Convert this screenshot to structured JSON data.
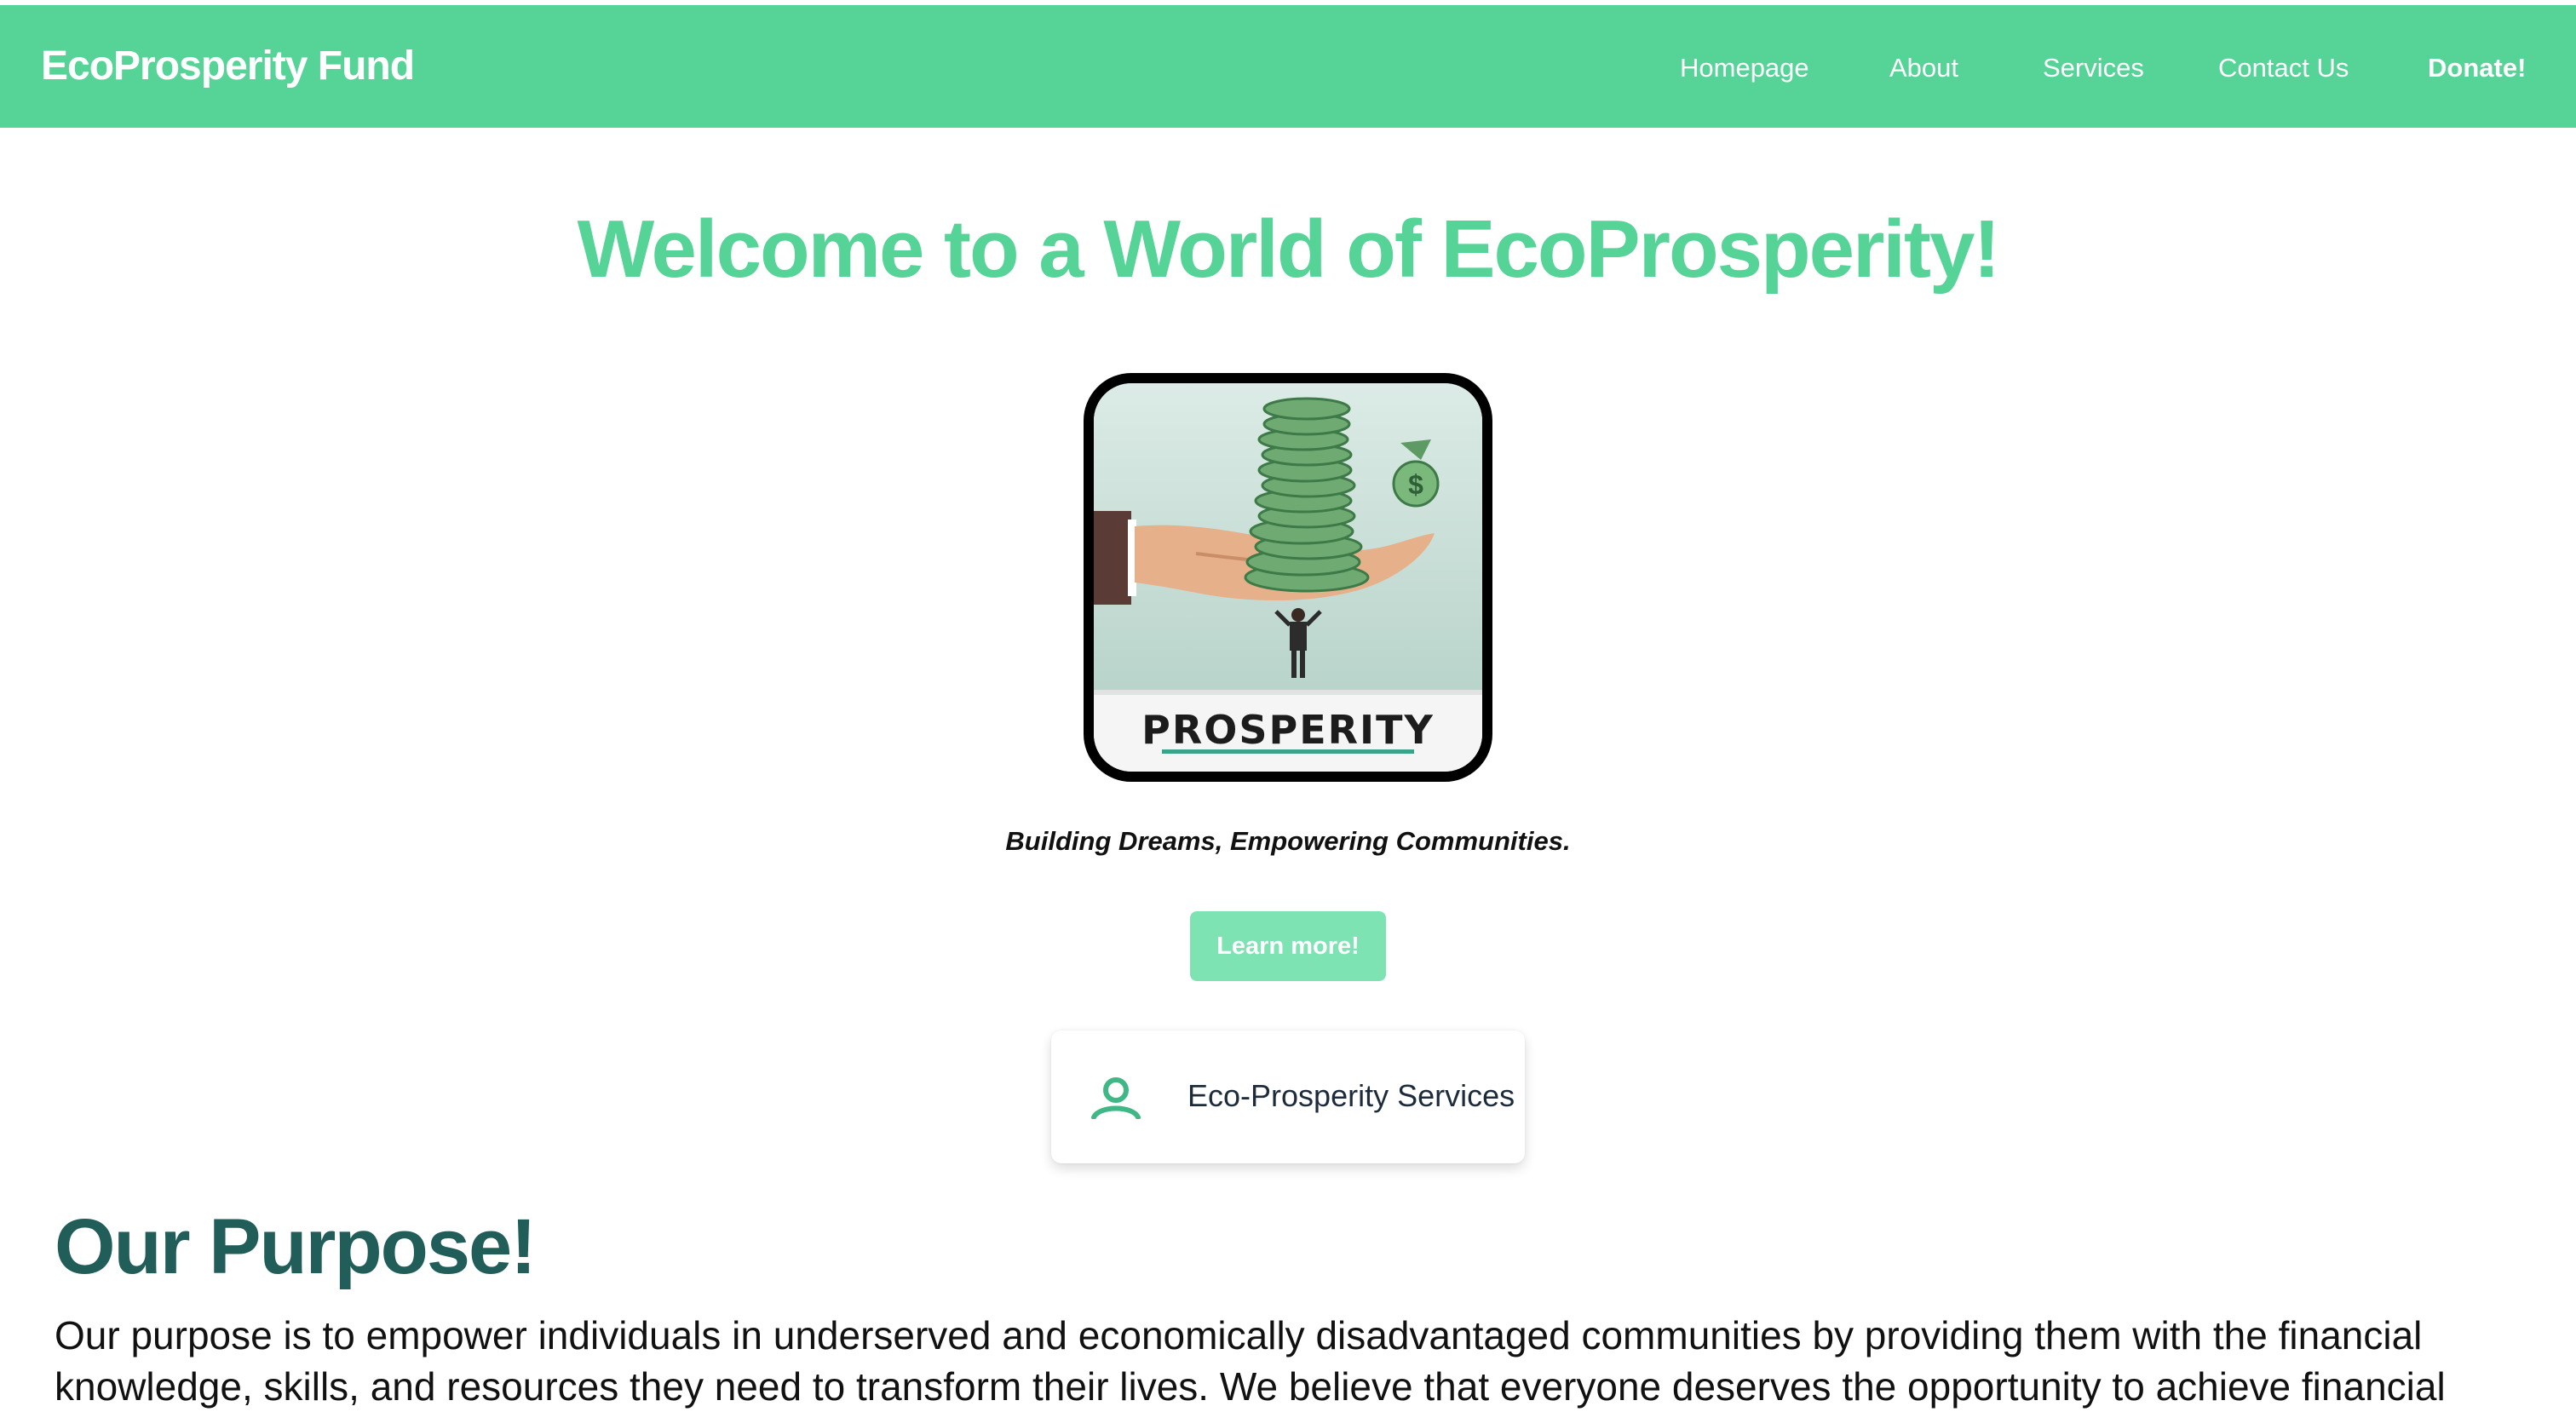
{
  "nav": {
    "brand": "EcoProsperity Fund",
    "links": [
      {
        "label": "Homepage"
      },
      {
        "label": "About"
      },
      {
        "label": "Services"
      },
      {
        "label": "Contact Us"
      },
      {
        "label": "Donate!"
      }
    ]
  },
  "hero": {
    "title": "Welcome to a World of EcoProsperity!",
    "image_caption": "PROSPERITY",
    "image_icon": "hand-holding-coins-illustration",
    "tagline": "Building Dreams, Empowering Communities.",
    "cta_label": "Learn more!"
  },
  "services_card": {
    "icon": "user-icon",
    "label": "Eco-Prosperity Services"
  },
  "purpose": {
    "title": "Our Purpose!",
    "body": "Our purpose is to empower individuals in underserved and economically disadvantaged communities by providing them with the financial knowledge, skills, and resources they need to transform their lives. We believe that everyone deserves the opportunity to achieve financial"
  },
  "colors": {
    "brand_green": "#56d396",
    "button_green": "#7ee3b3",
    "heading_teal": "#215e59"
  }
}
